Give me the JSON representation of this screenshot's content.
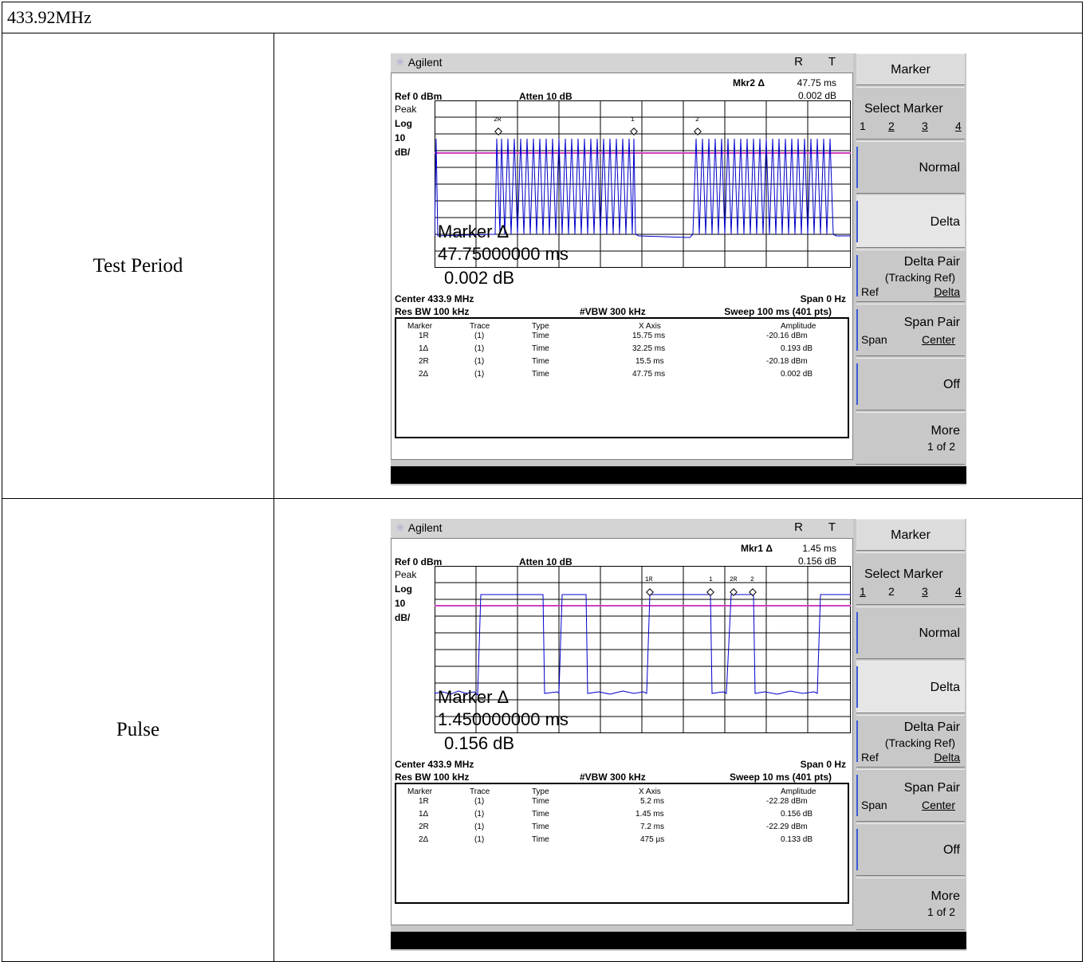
{
  "table": {
    "header": "433.92MHz",
    "rows": [
      {
        "label": "Test Period",
        "analyzer": {
          "brand": "Agilent",
          "rt": "R T",
          "mkr_title": "Mkr2 Δ",
          "mkr_time": "47.75 ms",
          "mkr_amp": "0.002 dB",
          "ref": "Ref 0 dBm",
          "atten": "Atten 10 dB",
          "peak": "Peak",
          "log": "Log",
          "ten": "10",
          "dbdiv": "dB/",
          "overlay_title": "Marker Δ",
          "overlay_time": "47.75000000 ms",
          "overlay_amp": "0.002 dB",
          "center": "Center 433.9 MHz",
          "span": "Span 0 Hz",
          "res_bw": "Res BW 100 kHz",
          "vbw": "#VBW 300 kHz",
          "sweep": "Sweep 100 ms (401 pts)",
          "marker_labels": [
            "2R",
            "1",
            "2"
          ],
          "table_headers": [
            "Marker",
            "Trace",
            "Type",
            "X Axis",
            "Amplitude"
          ],
          "table_rows": [
            [
              "1R",
              "(1)",
              "Time",
              "15.75 ms",
              "-20.16 dBm"
            ],
            [
              "1Δ",
              "(1)",
              "Time",
              "32.25 ms",
              "0.193 dB"
            ],
            [
              "2R",
              "(1)",
              "Time",
              "15.5 ms",
              "-20.18 dBm"
            ],
            [
              "2Δ",
              "(1)",
              "Time",
              "47.75 ms",
              "0.002 dB"
            ]
          ]
        }
      },
      {
        "label": "Pulse",
        "analyzer": {
          "brand": "Agilent",
          "rt": "R T",
          "mkr_title": "Mkr1 Δ",
          "mkr_time": "1.45 ms",
          "mkr_amp": "0.156 dB",
          "ref": "Ref 0 dBm",
          "atten": "Atten 10 dB",
          "peak": "Peak",
          "log": "Log",
          "ten": "10",
          "dbdiv": "dB/",
          "overlay_title": "Marker Δ",
          "overlay_time": "1.450000000 ms",
          "overlay_amp": "0.156 dB",
          "center": "Center 433.9 MHz",
          "span": "Span 0 Hz",
          "res_bw": "Res BW 100 kHz",
          "vbw": "#VBW 300 kHz",
          "sweep": "Sweep 10 ms (401 pts)",
          "marker_labels": [
            "1R",
            "1",
            "2R",
            "2"
          ],
          "table_headers": [
            "Marker",
            "Trace",
            "Type",
            "X Axis",
            "Amplitude"
          ],
          "table_rows": [
            [
              "1R",
              "(1)",
              "Time",
              "5.2 ms",
              "-22.28 dBm"
            ],
            [
              "1Δ",
              "(1)",
              "Time",
              "1.45 ms",
              "0.156 dB"
            ],
            [
              "2R",
              "(1)",
              "Time",
              "7.2 ms",
              "-22.29 dBm"
            ],
            [
              "2Δ",
              "(1)",
              "Time",
              "475 µs",
              "0.133 dB"
            ]
          ]
        }
      }
    ]
  },
  "softkeys": {
    "marker": "Marker",
    "select_marker": "Select Marker",
    "select_nums": [
      "1",
      "2",
      "3",
      "4"
    ],
    "normal": "Normal",
    "delta": "Delta",
    "delta_pair": "Delta Pair",
    "tracking_ref": "(Tracking Ref)",
    "ref": "Ref",
    "delta_sub": "Delta",
    "span_pair": "Span Pair",
    "span": "Span",
    "center": "Center",
    "off": "Off",
    "more": "More",
    "more_page": "1 of 2"
  },
  "colors": {
    "trace": "#0000cc",
    "threshold": "#d040c0",
    "grid": "#000000",
    "key_bracket": "#3a5ad8"
  }
}
